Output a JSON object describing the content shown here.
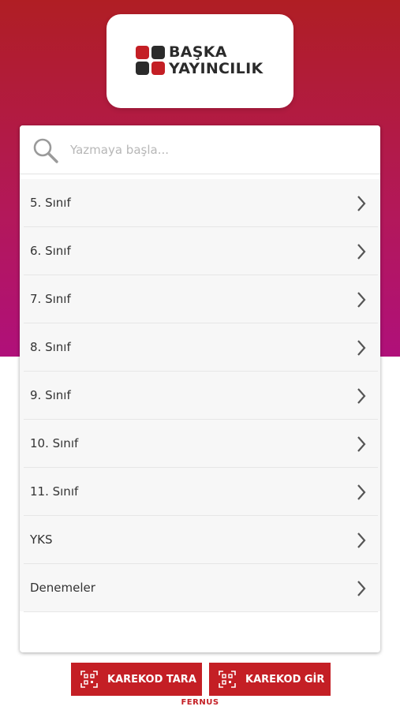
{
  "colors": {
    "brand_red": "#c41f25",
    "logo_dark": "#2b2b2b",
    "header_gradient_top": "#b01e24",
    "header_gradient_bottom": "#b0107a"
  },
  "logo": {
    "line1": "BAŞKA",
    "line2": "YAYINCILIK",
    "mark_icon": "four-squares-logo-icon"
  },
  "search": {
    "placeholder": "Yazmaya başla...",
    "value": "",
    "icon": "search-icon"
  },
  "list": {
    "items": [
      {
        "label": "5. Sınıf"
      },
      {
        "label": "6. Sınıf"
      },
      {
        "label": "7. Sınıf"
      },
      {
        "label": "8. Sınıf"
      },
      {
        "label": "9. Sınıf"
      },
      {
        "label": "10. Sınıf"
      },
      {
        "label": "11. Sınıf"
      },
      {
        "label": "YKS"
      },
      {
        "label": "Denemeler"
      }
    ],
    "item_icon": "chevron-right-icon"
  },
  "actions": {
    "scan_label": "KAREKOD TARA",
    "enter_label": "KAREKOD GİR",
    "icon": "qr-code-icon"
  },
  "footer": {
    "brand": "FERNUS"
  }
}
